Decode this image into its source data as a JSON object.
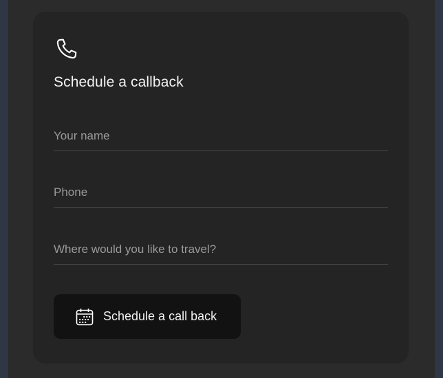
{
  "form": {
    "title": "Schedule a callback",
    "fields": {
      "name": {
        "placeholder": "Your name",
        "value": ""
      },
      "phone": {
        "placeholder": "Phone",
        "value": ""
      },
      "travel": {
        "placeholder": "Where would you like to travel?",
        "value": ""
      }
    },
    "submit_label": "Schedule a call back"
  },
  "icons": {
    "header": "phone-icon",
    "submit": "calendar-icon"
  },
  "colors": {
    "page_background": "#2f3746",
    "panel_background": "#2b2b2b",
    "card_background": "#242424",
    "button_background": "#121212",
    "text": "#f2f2f2",
    "placeholder": "#9a9a9a",
    "divider": "#4a4a4a"
  }
}
